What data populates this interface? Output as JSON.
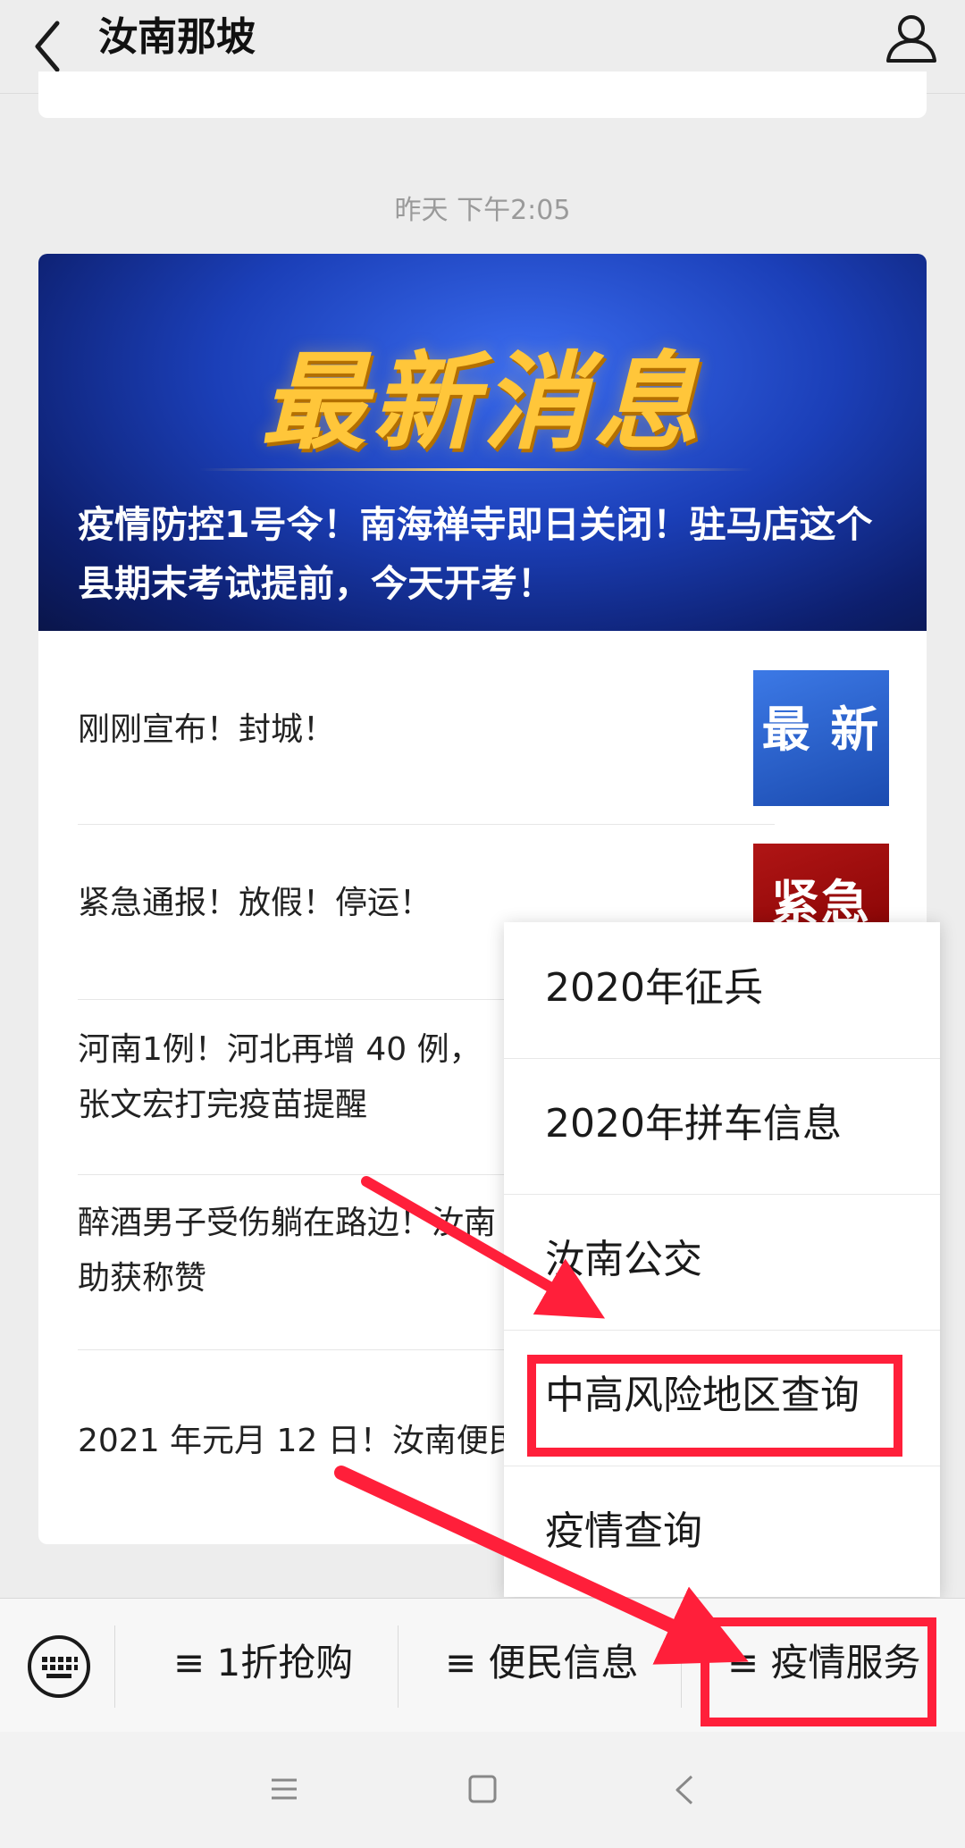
{
  "header": {
    "title": "汝南那坡"
  },
  "timestamp": "昨天 下午2:05",
  "article": {
    "banner_title": "最新消息",
    "headline": "疫情防控1号令！南海禅寺即日关闭！驻马店这个县期末考试提前，今天开考！",
    "items": [
      {
        "title": "刚刚宣布！封城！",
        "thumb_text": "最 新"
      },
      {
        "title": "紧急通报！放假！停运！",
        "thumb_text": "紧急"
      },
      {
        "title": "河南1例！河北再增 40 例，\n张文宏打完疫苗提醒"
      },
      {
        "title": "醉酒男子受伤躺在路边！汝南\n助获称赞"
      },
      {
        "title": "2021 年元月 12 日！汝南便民"
      }
    ]
  },
  "popup_menu": {
    "items": [
      {
        "label": "2020年征兵"
      },
      {
        "label": "2020年拼车信息"
      },
      {
        "label": "汝南公交"
      },
      {
        "label": "中高风险地区查询"
      },
      {
        "label": "疫情查询"
      }
    ]
  },
  "bottom_menu": {
    "tabs": [
      {
        "label": "≡ 1折抢购"
      },
      {
        "label": "≡ 便民信息"
      },
      {
        "label": "≡ 疫情服务"
      }
    ]
  },
  "colors": {
    "highlight": "#ff1f3a",
    "background": "#ededed",
    "banner_text": "#ffc63a"
  },
  "icons": [
    "back-arrow-icon",
    "user-icon",
    "keyboard-icon",
    "menu-icon",
    "home-icon",
    "back-icon"
  ]
}
